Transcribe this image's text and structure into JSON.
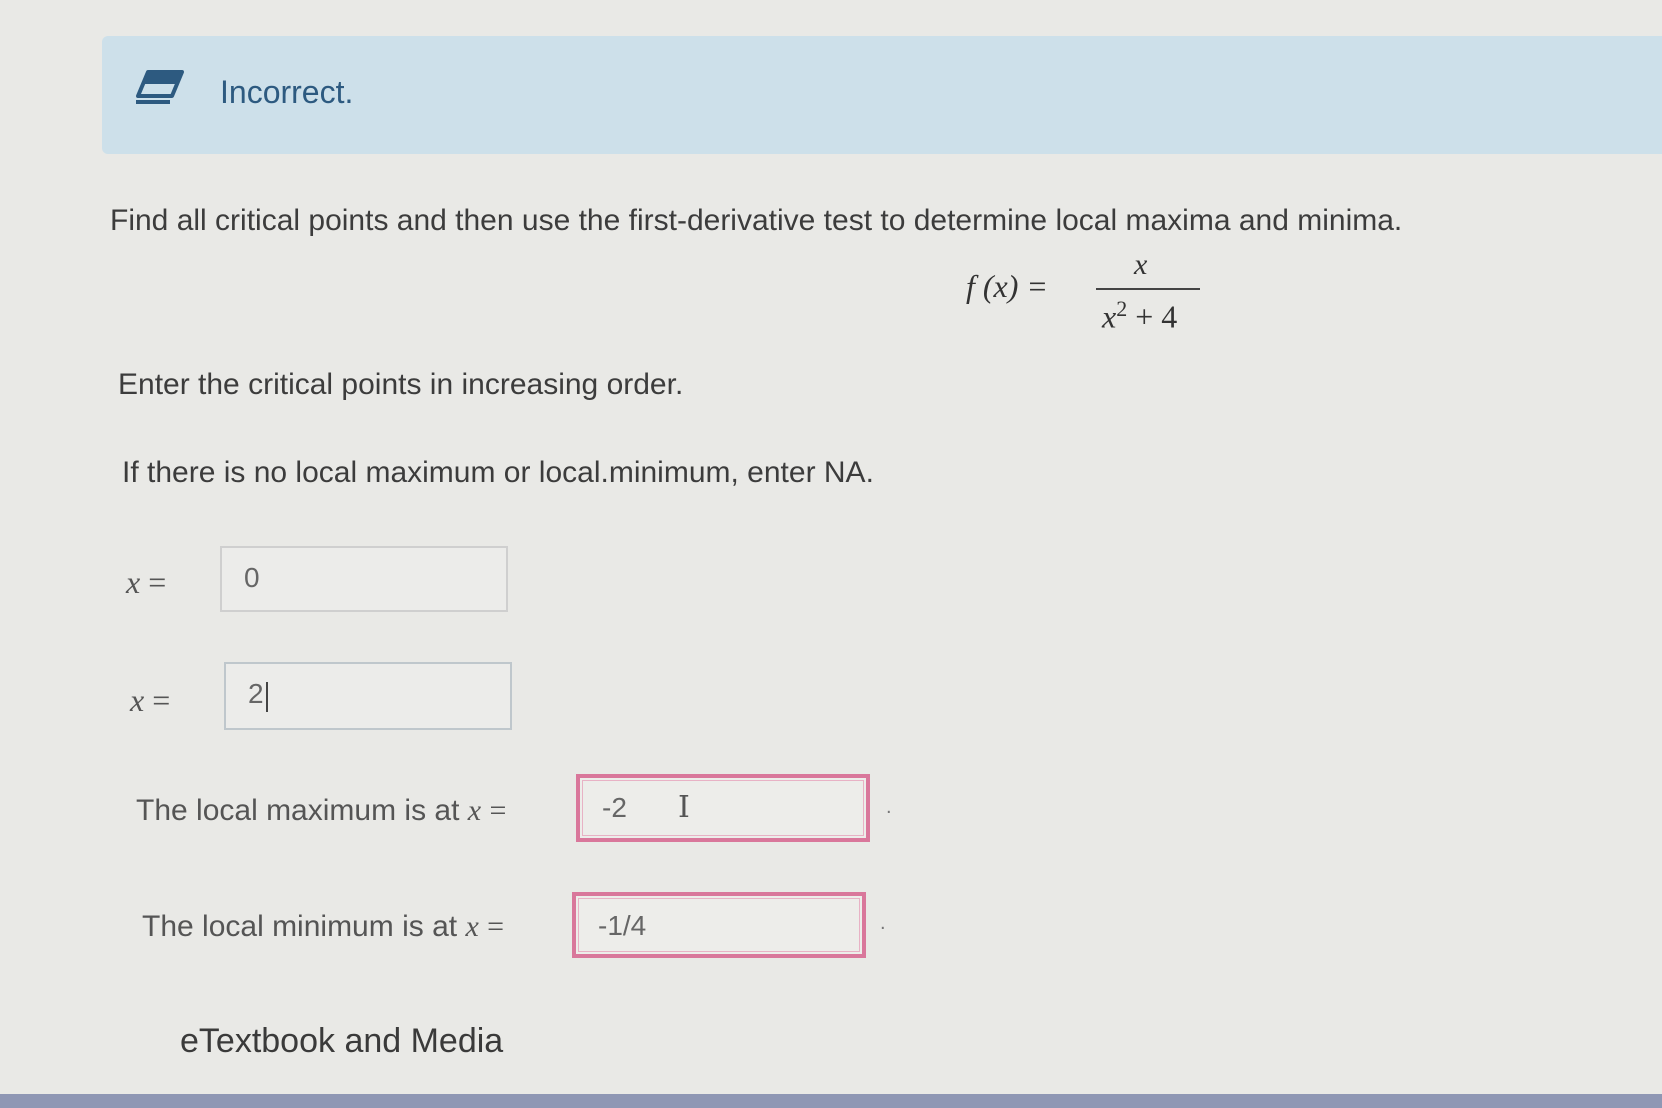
{
  "feedback": {
    "status_text": "Incorrect.",
    "icon": "eraser-icon",
    "color": "#2d5a80"
  },
  "question": {
    "instruction": "Find all critical points and then use the first-derivative test to determine local maxima and minima.",
    "function": {
      "lhs": "f (x) =",
      "numerator": "x",
      "denominator_base": "x",
      "denominator_exp": "2",
      "denominator_rest": "+ 4"
    },
    "order_note": "Enter the critical points in increasing order.",
    "na_note": "If there is no local maximum or local.minimum, enter NA."
  },
  "answers": {
    "critical_point_1": {
      "label_var": "x",
      "label_eq": "=",
      "value": "0"
    },
    "critical_point_2": {
      "label_var": "x",
      "label_eq": "=",
      "value": "2"
    },
    "local_max": {
      "label_text": "The local maximum is at ",
      "label_var": "x",
      "label_eq": "=",
      "value": "-2",
      "status": "incorrect"
    },
    "local_min": {
      "label_text": "The local minimum is at ",
      "label_var": "x",
      "label_eq": "=",
      "value": "-1/4",
      "status": "incorrect"
    },
    "period": "."
  },
  "footer": {
    "etextbook_link": "eTextbook and Media"
  },
  "colors": {
    "banner_bg": "#cde0ea",
    "error_border": "#d9779b"
  }
}
